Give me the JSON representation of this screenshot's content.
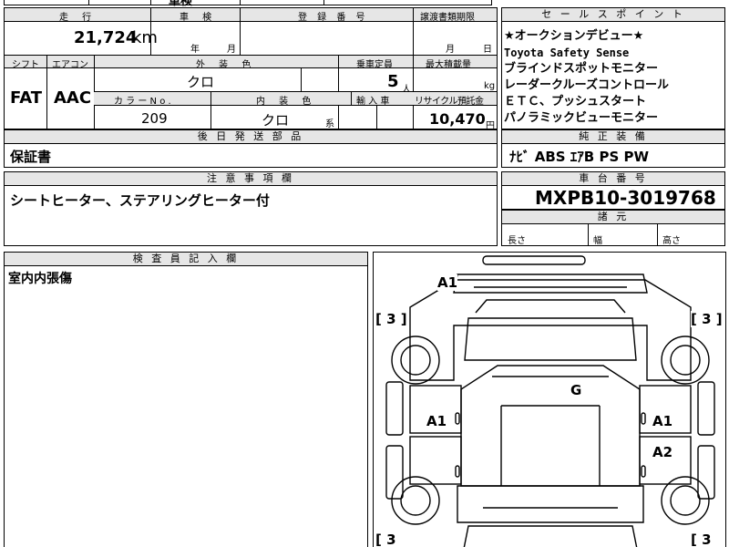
{
  "top_strip": {
    "partial_text": "車検"
  },
  "mileage": {
    "header": "走 行",
    "value": "21,724",
    "unit": "km"
  },
  "inspection": {
    "header": "車 検",
    "year_label": "年",
    "month_label": "月"
  },
  "registration": {
    "header": "登 録 番 号"
  },
  "transfer_deadline": {
    "header": "譲渡書類期限",
    "month_label": "月",
    "day_label": "日"
  },
  "shift": {
    "header": "シフト",
    "value": "FAT"
  },
  "aircon": {
    "header": "エアコン",
    "value": "AAC"
  },
  "exterior_color": {
    "header": "外 装 色",
    "value": "クロ"
  },
  "capacity": {
    "header": "乗車定員",
    "value": "5",
    "unit": "人"
  },
  "max_load": {
    "header": "最大積載量",
    "unit": "kg"
  },
  "color_no": {
    "header": "カ ラ ー N o .",
    "value": "209"
  },
  "interior_color": {
    "header": "内 装 色",
    "value": "クロ",
    "suffix": "系"
  },
  "import": {
    "header": "輸 入 車"
  },
  "recycle": {
    "header": "リサイクル預託金",
    "value": "10,470",
    "unit": "円"
  },
  "followup_parts": {
    "header": "後 日 発 送 部 品",
    "value": "保証書"
  },
  "sales_points": {
    "header": "セ ー ル ス ポ イ ン ト",
    "lines": [
      "★オークションデビュー★",
      "Toyota Safety Sense",
      "ブラインドスポットモニター",
      "レーダークルーズコントロール",
      "ＥＴＣ、プッシュスタート",
      "パノラミックビューモニター"
    ]
  },
  "genuine_equipment": {
    "header": "純 正 装 備",
    "value": "ﾅﾋﾞ ABS ｴｱB PS PW"
  },
  "notes": {
    "header": "注 意 事 項 欄",
    "value": "シートヒーター、ステアリングヒーター付"
  },
  "chassis": {
    "header": "車 台 番 号",
    "value": "MXPB10-3019768"
  },
  "dimensions": {
    "header": "諸 元",
    "length": "長さ",
    "width": "幅",
    "height": "高さ"
  },
  "inspector": {
    "header": "検 査 員 記 入 欄",
    "value": "室内内張傷"
  },
  "damage_map": {
    "marks": {
      "a1_top": "A1",
      "g": "G",
      "a1_left": "A1",
      "a1_right": "A1",
      "a2_right": "A2",
      "tire_fl": "[ 3 ]",
      "tire_fr": "[ 3 ]",
      "tire_rl": "[ 3",
      "tire_rr": "[ 3"
    }
  }
}
